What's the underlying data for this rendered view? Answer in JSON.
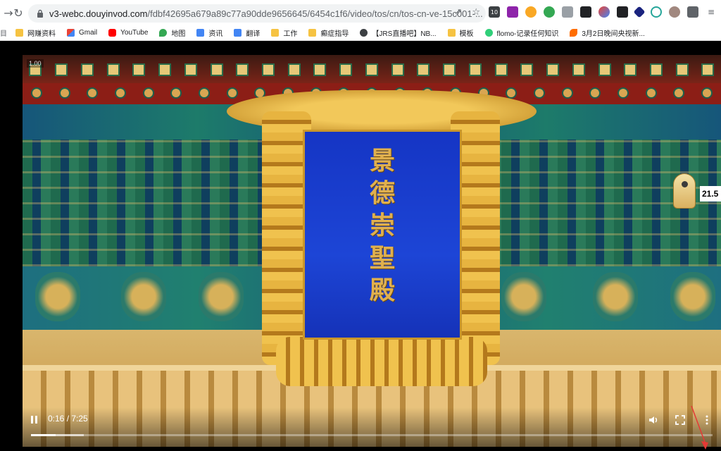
{
  "browser": {
    "url_host": "v3-webc.douyinvod.com",
    "url_path": "/fdbf42695a679a89c77a90dde9656645/6454c1f6/video/tos/cn/tos-cn-ve-15c001-...",
    "bookmarks": [
      {
        "label": "网赚资料",
        "icon": "folder-icon"
      },
      {
        "label": "Gmail",
        "icon": "gmail-icon"
      },
      {
        "label": "YouTube",
        "icon": "youtube-icon"
      },
      {
        "label": "地图",
        "icon": "maps-icon"
      },
      {
        "label": "资讯",
        "icon": "news-icon"
      },
      {
        "label": "翻译",
        "icon": "translate-icon"
      },
      {
        "label": "工作",
        "icon": "folder-icon"
      },
      {
        "label": "癫症指导",
        "icon": "folder-icon"
      },
      {
        "label": "【JRS直播吧】NB...",
        "icon": "globe-icon"
      },
      {
        "label": "模板",
        "icon": "folder-icon"
      },
      {
        "label": "flomo-记录任何知识",
        "icon": "flomo-icon"
      },
      {
        "label": "3月2日晚间央视新...",
        "icon": "feather-icon"
      }
    ],
    "ext_badge_text": "10",
    "accent_color": "#1a73e8"
  },
  "video": {
    "corner_badge": "1.00",
    "plaque_chars": [
      "景",
      "德",
      "崇",
      "聖",
      "殿"
    ],
    "speed_tag": "21.5"
  },
  "player": {
    "time_text": "0:16 / 7:25",
    "progress_played_fraction": 0.036,
    "progress_buffered_fraction": 0.077
  }
}
